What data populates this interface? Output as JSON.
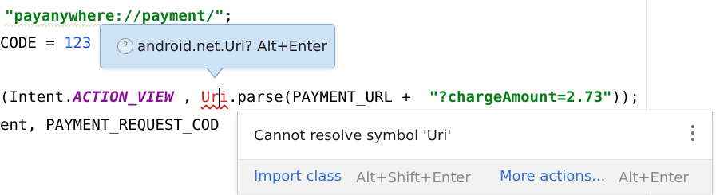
{
  "code": {
    "line1_str": "\"payanywhere://payment/\"",
    "line1_end": ";",
    "line2_pre": "CODE = ",
    "line2_num": "123",
    "line3_pre": "(Intent.",
    "line3_const": "ACTION_VIEW",
    "line3_mid1": " , ",
    "line3_err_a": "Ur",
    "line3_err_b": "i",
    "line3_mid2": ".parse(PAYMENT_URL +  ",
    "line3_str": "\"?chargeAmount=2.73\"",
    "line3_end": "));",
    "line4": "ent, PAYMENT_REQUEST_COD"
  },
  "hint": {
    "icon": "question-icon",
    "icon_glyph": "?",
    "text": "android.net.Uri? Alt+Enter"
  },
  "popup": {
    "message": "Cannot resolve symbol 'Uri'",
    "menu_icon": "more-vertical-icon",
    "import_label": "Import class",
    "import_shortcut": "Alt+Shift+Enter",
    "more_label": "More actions...",
    "more_shortcut": "Alt+Enter"
  },
  "colors": {
    "string": "#067d17",
    "number": "#1750eb",
    "constant": "#871094",
    "error": "#d11f1f",
    "hint_bg": "#cfe3f6",
    "link": "#3574d4"
  }
}
